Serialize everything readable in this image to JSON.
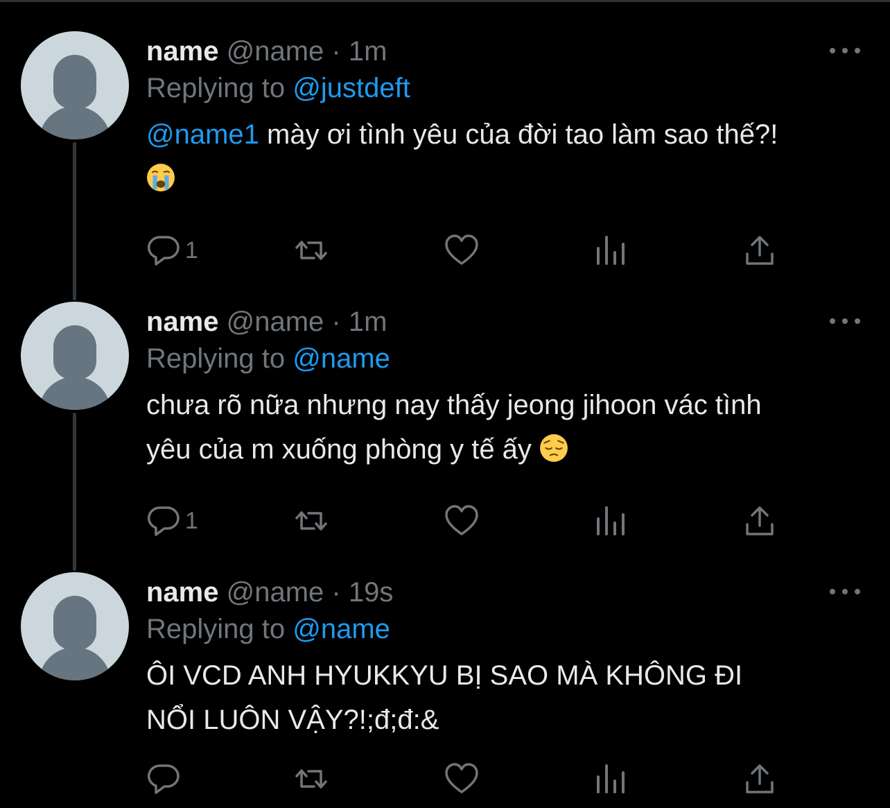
{
  "colors": {
    "background": "#000000",
    "text": "#e7e9ea",
    "muted": "#71767b",
    "link": "#1d9bf0",
    "avatar_bg": "#ccd6dd",
    "avatar_fg": "#66757f"
  },
  "tweets": [
    {
      "name": "name",
      "handle": "@name",
      "separator": "·",
      "time": "1m",
      "replying_prefix": "Replying to",
      "replying_to": "@justdeft",
      "mention": "@name1",
      "text_line1": " mày ơi tình yêu của đời tao làm sao thế?!",
      "text_line2": "",
      "emoji": "crying-face-emoji",
      "reply_count": "1"
    },
    {
      "name": "name",
      "handle": "@name",
      "separator": "·",
      "time": "1m",
      "replying_prefix": "Replying to",
      "replying_to": "@name",
      "text_line1": "chưa rõ nữa nhưng nay thấy jeong jihoon vác tình",
      "text_line2": "yêu của m xuống phòng y tế ấy ",
      "emoji": "pensive-face-emoji",
      "reply_count": "1"
    },
    {
      "name": "name",
      "handle": "@name",
      "separator": "·",
      "time": "19s",
      "replying_prefix": "Replying to",
      "replying_to": "@name",
      "text_line1": "ÔI VCD ANH HYUKKYU BỊ SAO MÀ KHÔNG ĐI",
      "text_line2": "NỔI LUÔN VẬY?!;đ;đ:&",
      "emoji": "",
      "reply_count": ""
    }
  ],
  "icons": [
    "reply-icon",
    "retweet-icon",
    "like-icon",
    "views-icon",
    "share-icon",
    "more-icon"
  ]
}
